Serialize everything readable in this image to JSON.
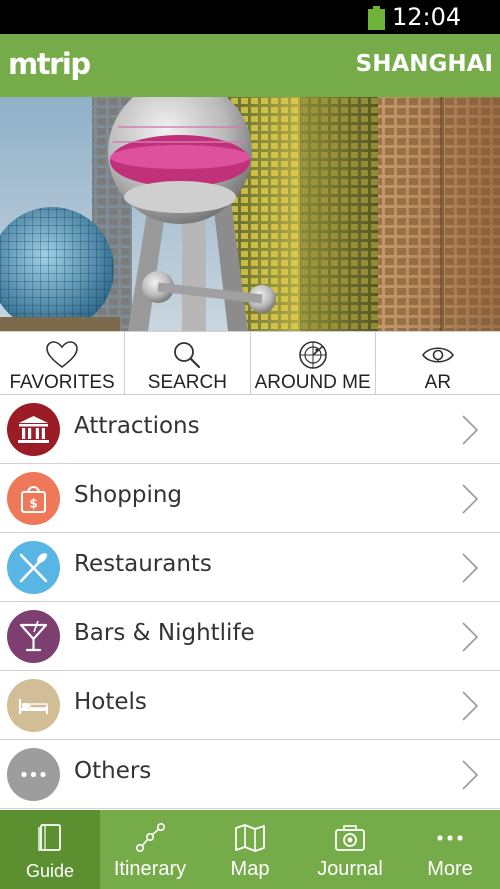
{
  "status_bar": {
    "time": "12:04 PM",
    "battery_icon": "battery-icon"
  },
  "app_bar": {
    "logo": "mtrip",
    "city": "SHANGHAI"
  },
  "hero": {
    "image": "shanghai-skyline-photo"
  },
  "quick_actions": [
    {
      "label": "FAVORITES",
      "icon": "heart-icon"
    },
    {
      "label": "SEARCH",
      "icon": "search-icon"
    },
    {
      "label": "AROUND ME",
      "icon": "radar-icon"
    },
    {
      "label": "AR",
      "icon": "eye-icon"
    }
  ],
  "categories": [
    {
      "label": "Attractions",
      "icon": "museum-icon",
      "color": "#9b1c24"
    },
    {
      "label": "Shopping",
      "icon": "shopping-bag-icon",
      "color": "#ef7859"
    },
    {
      "label": "Restaurants",
      "icon": "cutlery-icon",
      "color": "#59b5e3"
    },
    {
      "label": "Bars & Nightlife",
      "icon": "cocktail-icon",
      "color": "#7d3f6f"
    },
    {
      "label": "Hotels",
      "icon": "bed-icon",
      "color": "#d1bd96"
    },
    {
      "label": "Others",
      "icon": "more-dots-icon",
      "color": "#9d9d9d"
    }
  ],
  "tab_bar": [
    {
      "label": "Guide",
      "icon": "book-icon",
      "active": true
    },
    {
      "label": "Itinerary",
      "icon": "route-icon",
      "active": false
    },
    {
      "label": "Map",
      "icon": "map-icon",
      "active": false
    },
    {
      "label": "Journal",
      "icon": "camera-icon",
      "active": false
    },
    {
      "label": "More",
      "icon": "more-dots-icon",
      "active": false
    }
  ],
  "colors": {
    "brand_green": "#76ab49",
    "active_tab": "#5b8f30",
    "status_bar": "#000000",
    "battery": "#6fb23a"
  }
}
